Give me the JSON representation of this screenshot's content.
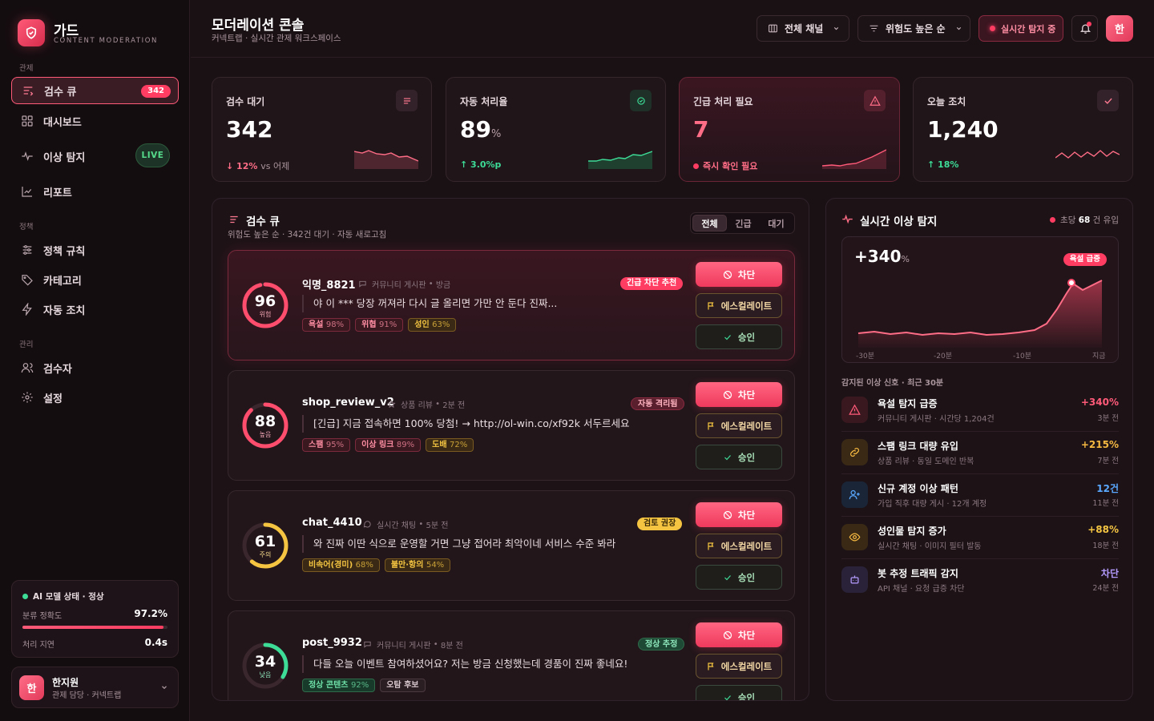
{
  "brand": {
    "title": "가드",
    "subtitle": "CONTENT MODERATION",
    "initial": "한"
  },
  "sidebar": {
    "sections": [
      "관제",
      "정책",
      "관리"
    ],
    "items": [
      {
        "label": "검수 큐",
        "badge": "342"
      },
      {
        "label": "대시보드"
      },
      {
        "label": "이상 탐지",
        "badge": "LIVE"
      },
      {
        "label": "리포트"
      },
      {
        "label": "정책 규칙"
      },
      {
        "label": "카테고리"
      },
      {
        "label": "자동 조치"
      },
      {
        "label": "검수자"
      },
      {
        "label": "설정"
      }
    ],
    "ai_status": {
      "title": "AI 모델 상태 · 정상",
      "accuracy_label": "분류 정확도",
      "accuracy": "97.2%",
      "accuracy_fraction": 0.972,
      "latency_label": "처리 지연",
      "latency": "0.4s"
    },
    "user": {
      "name": "한지원",
      "role": "관제 담당 · 커넥트랩",
      "initial": "한"
    }
  },
  "header": {
    "title": "모더레이션 콘솔",
    "subtitle": "커넥트랩 · 실시간 관제 워크스페이스",
    "channel_filter": "전체 채널",
    "sort": "위험도 높은 순",
    "live_button": "실시간 탐지 중"
  },
  "stats": [
    {
      "label": "검수 대기",
      "value": "342",
      "unit": "",
      "delta": "12%",
      "delta_note": "vs 어제"
    },
    {
      "label": "자동 처리율",
      "value": "89",
      "unit": "%",
      "delta": "3.0%p",
      "delta_note": ""
    },
    {
      "label": "긴급 처리 필요",
      "value": "7",
      "unit": "",
      "delta": "즉시 확인 필요",
      "delta_note": ""
    },
    {
      "label": "오늘 조치",
      "value": "1,240",
      "unit": "",
      "delta": "18%",
      "delta_note": ""
    }
  ],
  "queue": {
    "title": "검수 큐",
    "subtitle": "위험도 높은 순 · 342건 대기 · 자동 새로고침",
    "tabs": [
      "전체",
      "긴급",
      "대기"
    ],
    "actions": {
      "block": "차단",
      "escalate": "에스컬레이트",
      "approve": "승인"
    },
    "items": [
      {
        "score": "96",
        "score_fraction": 0.96,
        "level": "위험",
        "user": "익명_8821",
        "source": "커뮤니티 게시판",
        "time": "방금",
        "message": "야 이 *** 당장 꺼져라 다시 글 올리면 가만 안 둔다 진짜...",
        "verdict": "긴급 차단 추천",
        "tags": [
          {
            "label": "욕설",
            "pct": "98%"
          },
          {
            "label": "위협",
            "pct": "91%"
          },
          {
            "label": "성인",
            "pct": "63%"
          }
        ]
      },
      {
        "score": "88",
        "score_fraction": 0.88,
        "level": "높음",
        "user": "shop_review_v2",
        "source": "상품 리뷰",
        "time": "2분 전",
        "message": "[긴급] 지금 접속하면 100% 당첨! → http://ol-win.co/xf92k 서두르세요",
        "verdict": "자동 격리됨",
        "tags": [
          {
            "label": "스팸",
            "pct": "95%"
          },
          {
            "label": "이상 링크",
            "pct": "89%"
          },
          {
            "label": "도배",
            "pct": "72%"
          }
        ]
      },
      {
        "score": "61",
        "score_fraction": 0.61,
        "level": "주의",
        "user": "chat_4410",
        "source": "실시간 채팅",
        "time": "5분 전",
        "message": "와 진짜 이딴 식으로 운영할 거면 그냥 접어라 최악이네 서비스 수준 봐라",
        "verdict": "검토 권장",
        "tags": [
          {
            "label": "비속어(경미)",
            "pct": "68%"
          },
          {
            "label": "불만·항의",
            "pct": "54%"
          }
        ]
      },
      {
        "score": "34",
        "score_fraction": 0.34,
        "level": "낮음",
        "user": "post_9932",
        "source": "커뮤니티 게시판",
        "time": "8분 전",
        "message": "다들 오늘 이벤트 참여하셨어요? 저는 방금 신청했는데 경품이 진짜 좋네요!",
        "verdict": "정상 추정",
        "tags": [
          {
            "label": "정상 콘텐츠",
            "pct": "92%"
          },
          {
            "label": "오탐 후보",
            "pct": ""
          }
        ]
      }
    ]
  },
  "anomaly": {
    "title": "실시간 이상 탐지",
    "rate_prefix": "초당",
    "rate": "68",
    "rate_suffix": "건 유입",
    "chart_value": "+340",
    "chart_unit": "%",
    "chart_badge": "욕설 급증",
    "chart_xlabels": [
      "-30분",
      "-20분",
      "-10분",
      "지금"
    ],
    "signals_title": "감지된 이상 신호 · 최근 30분",
    "signals": [
      {
        "title": "욕설 탐지 급증",
        "sub": "커뮤니티 게시판 · 시간당 1,204건",
        "value": "+340%",
        "ago": "3분 전",
        "icon": "warning-icon",
        "color": "#ff5a78"
      },
      {
        "title": "스팸 링크 대량 유입",
        "sub": "상품 리뷰 · 동일 도메인 반복",
        "value": "+215%",
        "ago": "7분 전",
        "icon": "link-icon",
        "color": "#f5b841"
      },
      {
        "title": "신규 계정 이상 패턴",
        "sub": "가입 직후 대량 게시 · 12개 계정",
        "value": "12건",
        "ago": "11분 전",
        "icon": "user-plus-icon",
        "color": "#5aa8ff"
      },
      {
        "title": "성인물 탐지 증가",
        "sub": "실시간 채팅 · 이미지 필터 발동",
        "value": "+88%",
        "ago": "18분 전",
        "icon": "eye-icon",
        "color": "#f5b841"
      },
      {
        "title": "봇 추정 트래픽 감지",
        "sub": "API 채널 · 요청 급증 차단",
        "value": "차단",
        "ago": "24분 전",
        "icon": "bot-icon",
        "color": "#b49bff"
      }
    ]
  },
  "colors": {
    "accent": "#ff4d6d",
    "danger": "#ff5a78",
    "warn": "#f5c542",
    "good": "#3ddc97"
  }
}
